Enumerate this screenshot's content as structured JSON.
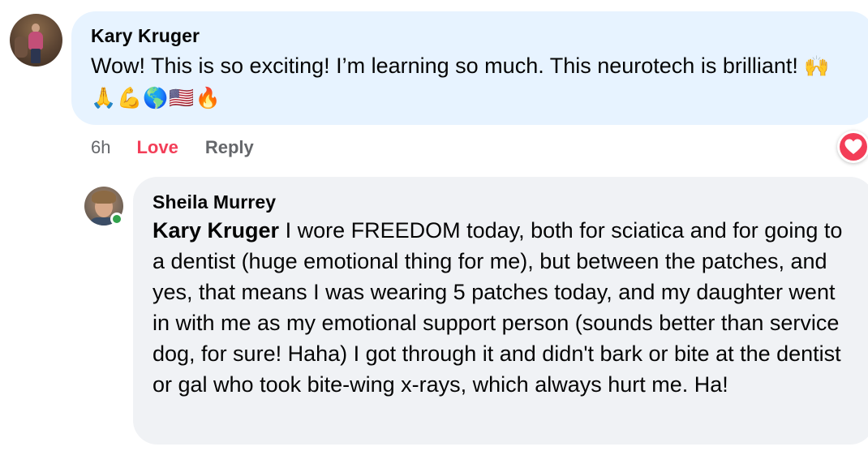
{
  "comment": {
    "author": "Kary Kruger",
    "text": "Wow! This is so exciting! I’m learning so much. This neurotech is brilliant!",
    "emojis": "🙌🙏💪🌎🇺🇸🔥",
    "time": "6h",
    "love_label": "Love",
    "reply_label": "Reply",
    "reaction": "love-icon",
    "reaction_color": "#f33e58",
    "bubble_color": "#e7f3ff"
  },
  "reply": {
    "author": "Sheila Murrey",
    "mention": "Kary Kruger",
    "text": " I wore FREEDOM today, both for sciatica and for going to a dentist (huge emotional thing for me), but between the patches, and yes, that means I was wearing 5 patches today, and my daughter went in with me as my emotional support person (sounds better than service dog, for sure! Haha) I got through it and didn't bark or bite at the dentist or gal who took bite-wing x-rays, which always hurt me. Ha!",
    "online": true,
    "online_color": "#31a24c",
    "bubble_color": "#f0f2f5"
  }
}
